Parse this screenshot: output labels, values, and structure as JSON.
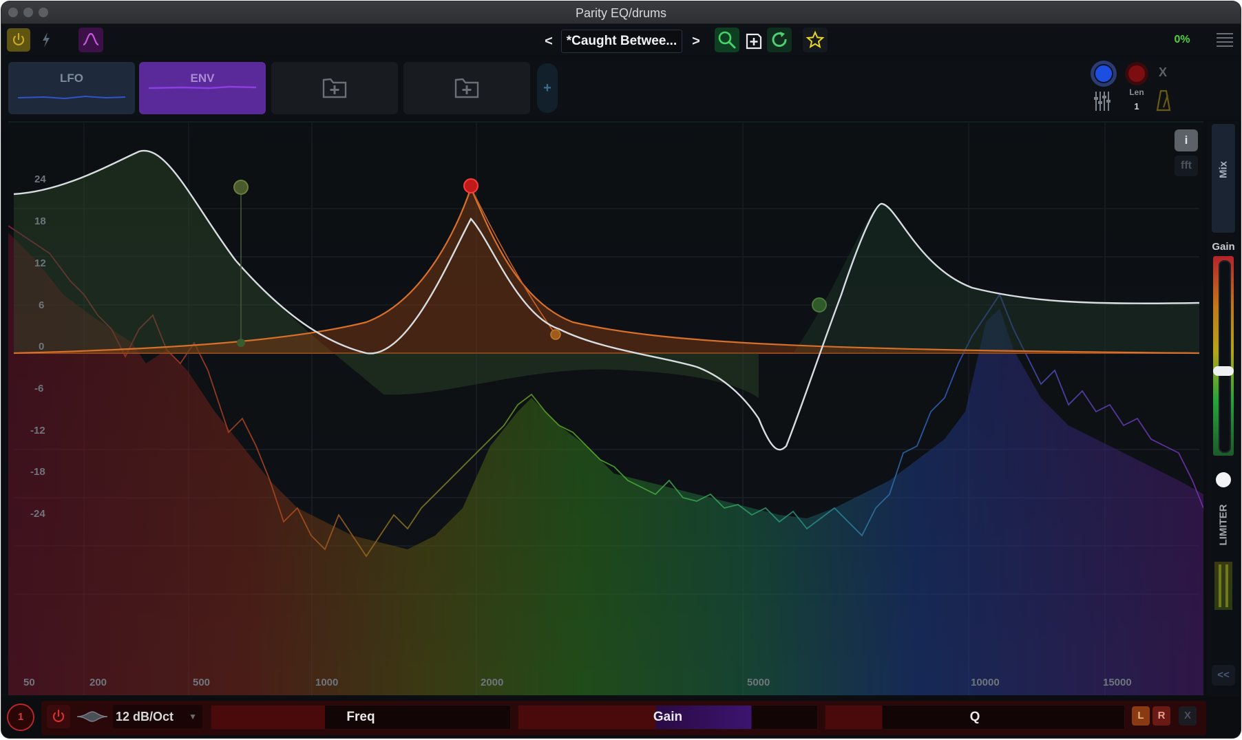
{
  "window": {
    "title": "Parity EQ/drums"
  },
  "toolbar": {
    "preset_prev": "<",
    "preset_name": "*Caught Betwee...",
    "preset_next": ">",
    "cpu": "0%"
  },
  "mod_slots": [
    {
      "label": "LFO"
    },
    {
      "label": "ENV"
    },
    {
      "label": ""
    },
    {
      "label": ""
    }
  ],
  "mod_add": "+",
  "seq": {
    "len_label": "Len",
    "len_value": "1",
    "close": "X"
  },
  "graph": {
    "info_button": "i",
    "fft_button": "fft",
    "db_labels": [
      "24",
      "18",
      "12",
      "6",
      "0",
      "-6",
      "-12",
      "-18",
      "-24"
    ],
    "freq_labels": [
      "50",
      "200",
      "500",
      "1000",
      "2000",
      "5000",
      "10000",
      "15000"
    ]
  },
  "side": {
    "mix": "Mix",
    "gain": "Gain",
    "limiter": "LIMITER",
    "collapse": "<<"
  },
  "bottom": {
    "band_number": "1",
    "slope": "12 dB/Oct",
    "freq": "Freq",
    "gain": "Gain",
    "q": "Q",
    "left": "L",
    "right": "R",
    "close": "X"
  },
  "colors": {
    "accent_red": "#e0252a",
    "band_orange": "#d9702a",
    "curve_white": "#d8dde2",
    "env_purple": "#5a2a9a"
  }
}
